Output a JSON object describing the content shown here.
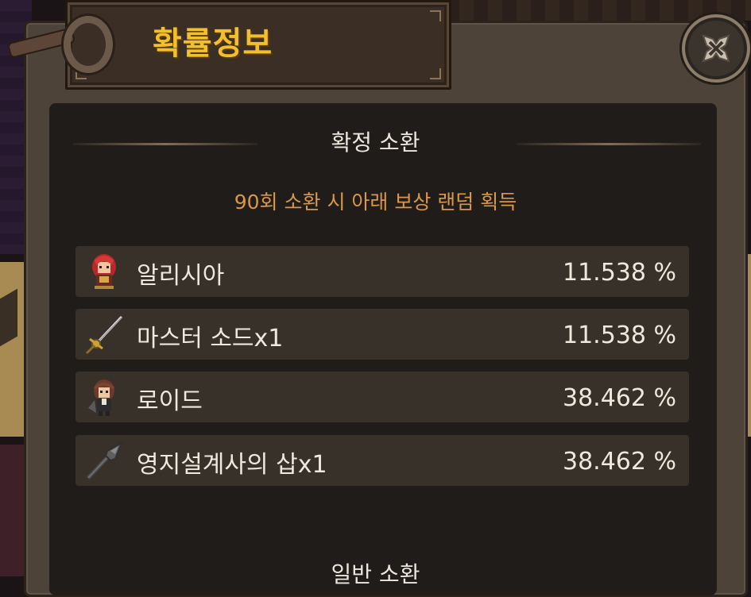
{
  "dialog": {
    "title": "확률정보",
    "close_icon": "close-x-icon"
  },
  "guaranteed": {
    "header": "확정 소환",
    "description": "90회 소환 시 아래 보상 랜덤 획득",
    "items": [
      {
        "name": "알리시아",
        "percent": "11.538 %",
        "icon": "alicia-character-icon"
      },
      {
        "name": "마스터 소드x1",
        "percent": "11.538 %",
        "icon": "master-sword-icon"
      },
      {
        "name": "로이드",
        "percent": "38.462 %",
        "icon": "lloyd-character-icon"
      },
      {
        "name": "영지설계사의 삽x1",
        "percent": "38.462 %",
        "icon": "shovel-icon"
      }
    ]
  },
  "normal": {
    "header": "일반 소환"
  },
  "colors": {
    "title": "#f2c02c",
    "description": "#d9974a",
    "row_bg": "#37312a",
    "panel_bg": "#1f1c19"
  }
}
